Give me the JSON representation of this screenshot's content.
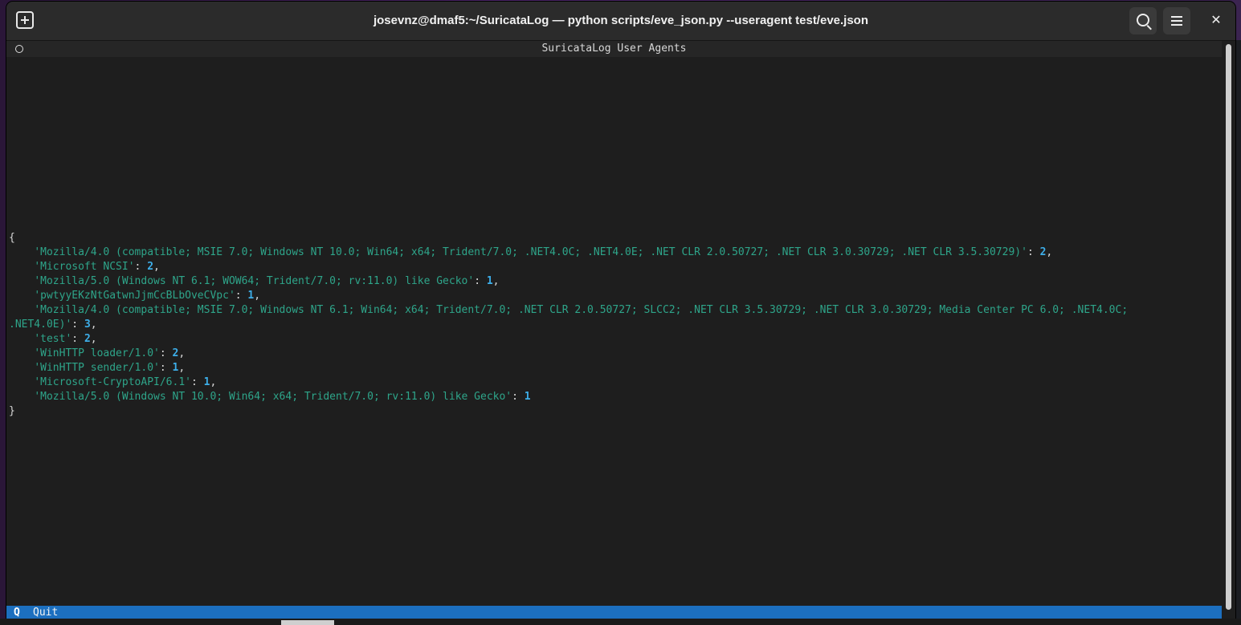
{
  "window": {
    "title": "josevnz@dmaf5:~/SuricataLog — python scripts/eve_json.py --useragent test/eve.json",
    "close_glyph": "✕"
  },
  "app": {
    "title": "SuricataLog User Agents"
  },
  "output": {
    "open_brace": "{",
    "close_brace": "}",
    "entries": [
      {
        "key": "'Mozilla/4.0 (compatible; MSIE 7.0; Windows NT 10.0; Win64; x64; Trident/7.0; .NET4.0C; .NET4.0E; .NET CLR 2.0.50727; .NET CLR 3.0.30729; .NET CLR 3.5.30729)'",
        "value": "2",
        "sep": ","
      },
      {
        "key": "'Microsoft NCSI'",
        "value": "2",
        "sep": ","
      },
      {
        "key": "'Mozilla/5.0 (Windows NT 6.1; WOW64; Trident/7.0; rv:11.0) like Gecko'",
        "value": "1",
        "sep": ","
      },
      {
        "key": "'pwtyyEKzNtGatwnJjmCcBLbOveCVpc'",
        "value": "1",
        "sep": ","
      },
      {
        "key_line1": "'Mozilla/4.0 (compatible; MSIE 7.0; Windows NT 6.1; Win64; x64; Trident/7.0; .NET CLR 2.0.50727; SLCC2; .NET CLR 3.5.30729; .NET CLR 3.0.30729; Media Center PC 6.0; .NET4.0C;",
        "key_line2": ".NET4.0E)'",
        "value": "3",
        "sep": ","
      },
      {
        "key": "'test'",
        "value": "2",
        "sep": ","
      },
      {
        "key": "'WinHTTP loader/1.0'",
        "value": "2",
        "sep": ","
      },
      {
        "key": "'WinHTTP sender/1.0'",
        "value": "1",
        "sep": ","
      },
      {
        "key": "'Microsoft-CryptoAPI/6.1'",
        "value": "1",
        "sep": ","
      },
      {
        "key": "'Mozilla/5.0 (Windows NT 10.0; Win64; x64; Trident/7.0; rv:11.0) like Gecko'",
        "value": "1",
        "sep": ""
      }
    ]
  },
  "footer": {
    "key": "Q",
    "label": "Quit"
  },
  "colors": {
    "key_text": "#2ea58a",
    "value_text": "#3daee9",
    "footer_bg": "#1c6fbf"
  }
}
